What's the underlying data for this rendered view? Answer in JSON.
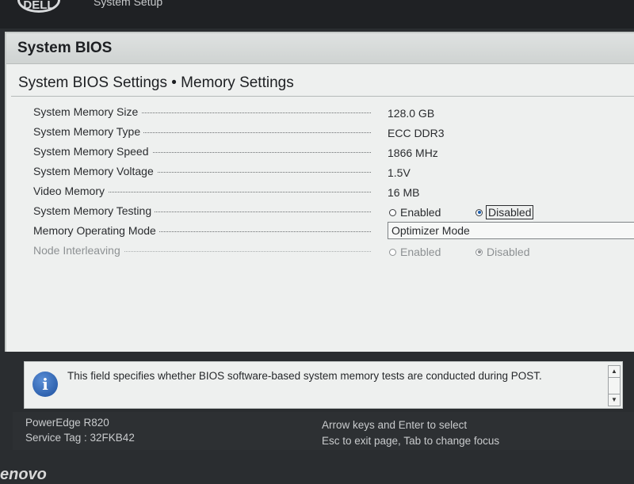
{
  "topbar": {
    "logo": "DELL",
    "title": "System Setup"
  },
  "window": {
    "title": "System BIOS"
  },
  "page": {
    "title": "System BIOS Settings • Memory Settings"
  },
  "settings": [
    {
      "label": "System Memory Size",
      "value": "128.0 GB"
    },
    {
      "label": "System Memory Type",
      "value": "ECC DDR3"
    },
    {
      "label": "System Memory Speed",
      "value": "1866 MHz"
    },
    {
      "label": "System Memory Voltage",
      "value": "1.5V"
    },
    {
      "label": "Video Memory",
      "value": "16 MB"
    },
    {
      "label": "System Memory Testing",
      "options": [
        "Enabled",
        "Disabled"
      ],
      "selected": "Disabled"
    },
    {
      "label": "Memory Operating Mode",
      "value": "Optimizer Mode"
    },
    {
      "label": "Node Interleaving",
      "options": [
        "Enabled",
        "Disabled"
      ],
      "selected": "Disabled",
      "disabled": true
    }
  ],
  "help": {
    "text": "This field specifies whether BIOS software-based system memory tests are conducted during POST."
  },
  "footer": {
    "model": "PowerEdge R820",
    "service_tag": "Service Tag : 32FKB42",
    "hint1": "Arrow keys and Enter to select",
    "hint2": "Esc to exit page, Tab to change focus"
  },
  "bezel": {
    "brand": "enovo"
  },
  "colors": {
    "radio_selected": "#1a5fb0",
    "footer_bg": "#2d3033",
    "window_bg": "#eef0ef"
  }
}
